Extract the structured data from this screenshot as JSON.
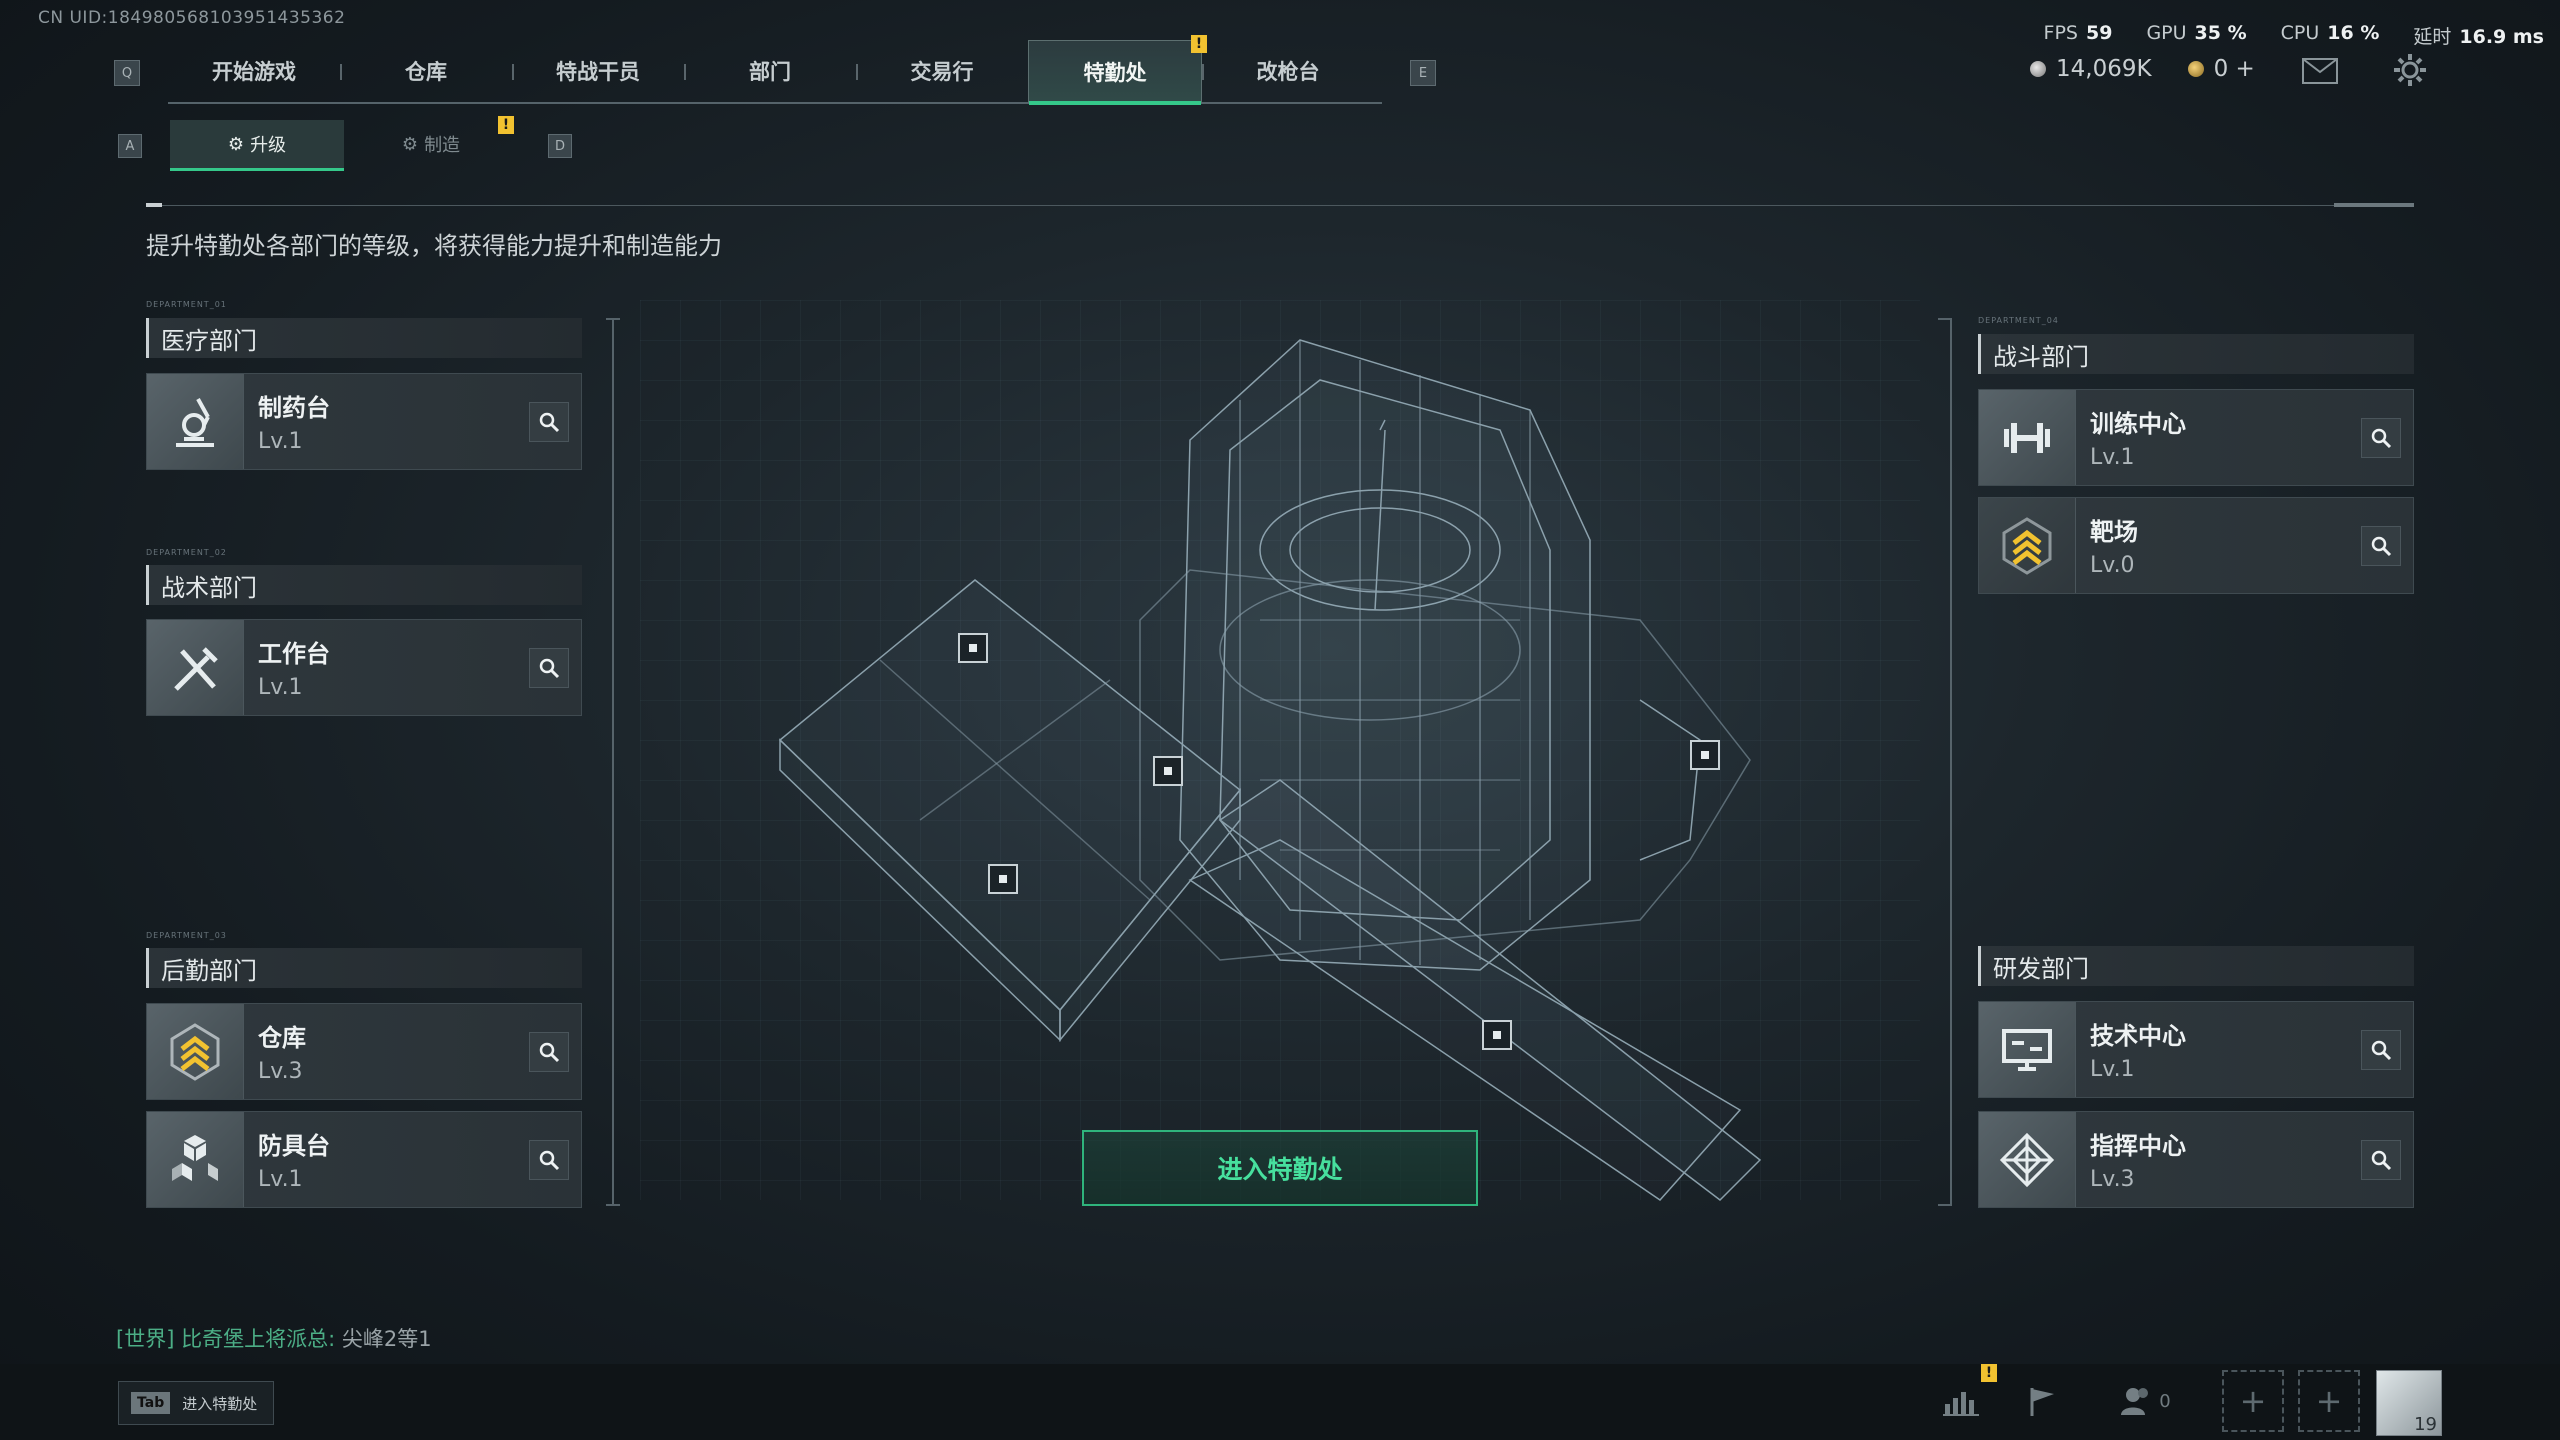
{
  "header": {
    "uid": "CN UID:184980568103951435362",
    "nav_key_left": "Q",
    "nav_key_right": "E",
    "tabs": [
      "开始游戏",
      "仓库",
      "特战干员",
      "部门",
      "交易行",
      "特勤处",
      "改枪台"
    ],
    "active_tab": "特勤处",
    "warn_mark": "!"
  },
  "stats": {
    "fps_label": "FPS",
    "fps": "59",
    "gpu_label": "GPU",
    "gpu": "35 %",
    "cpu_label": "CPU",
    "cpu": "16 %",
    "latency_label": "延时",
    "latency": "16.9 ms"
  },
  "currency": {
    "coins": "14,069K",
    "premium": "0 +"
  },
  "subtabs": {
    "key_left": "A",
    "key_right": "D",
    "upgrade": "升级",
    "craft": "制造"
  },
  "description": "提升特勤处各部门的等级，将获得能力提升和制造能力",
  "departments": {
    "medical": {
      "tag": "DEPARTMENT_01",
      "title": "医疗部门",
      "items": [
        {
          "name": "制药台",
          "level": "Lv.1",
          "icon": "microscope-icon"
        }
      ]
    },
    "tactical": {
      "tag": "DEPARTMENT_02",
      "title": "战术部门",
      "items": [
        {
          "name": "工作台",
          "level": "Lv.1",
          "icon": "tools-icon"
        }
      ]
    },
    "logistics": {
      "tag": "DEPARTMENT_03",
      "title": "后勤部门",
      "items": [
        {
          "name": "仓库",
          "level": "Lv.3",
          "icon": "rank-chevron-icon"
        },
        {
          "name": "防具台",
          "level": "Lv.1",
          "icon": "cubes-icon"
        }
      ]
    },
    "combat": {
      "tag": "DEPARTMENT_04",
      "title": "战斗部门",
      "items": [
        {
          "name": "训练中心",
          "level": "Lv.1",
          "icon": "dumbbell-icon"
        },
        {
          "name": "靶场",
          "level": "Lv.0",
          "icon": "rank-chevron-icon"
        }
      ]
    },
    "rnd": {
      "title": "研发部门",
      "items": [
        {
          "name": "技术中心",
          "level": "Lv.1",
          "icon": "monitor-icon"
        },
        {
          "name": "指挥中心",
          "level": "Lv.3",
          "icon": "diamond-grid-icon"
        }
      ]
    }
  },
  "enter_button": "进入特勤处",
  "chat": {
    "channel": "[世界]",
    "sender": "比奇堡上将派总:",
    "message": "尖峰2等1"
  },
  "bottom": {
    "tab_key": "Tab",
    "tab_hint": "进入特勤处",
    "friends_count": "0",
    "avatar_level": "19"
  },
  "colors": {
    "accent": "#35c88a",
    "warning": "#f2c230"
  }
}
